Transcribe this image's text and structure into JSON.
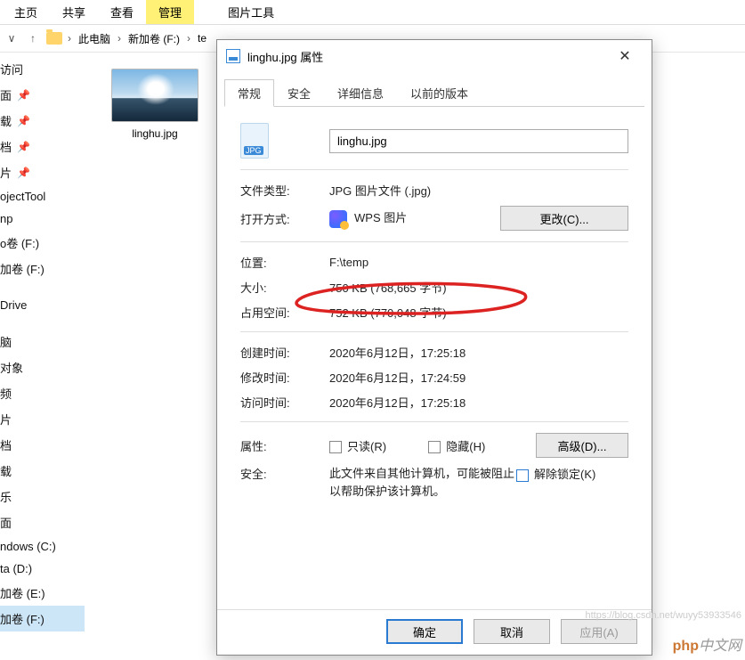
{
  "ribbon": {
    "tabs": [
      "主页",
      "共享",
      "查看"
    ],
    "context_group": "管理",
    "context_tab": "图片工具"
  },
  "breadcrumbs": {
    "items": [
      "此电脑",
      "新加卷 (F:)",
      "te"
    ],
    "address_extra": "temp"
  },
  "sidebar": {
    "items": [
      "访问",
      "面",
      "载",
      "档",
      "片",
      "ojectTool",
      "np",
      "o卷 (F:)",
      "加卷 (F:)",
      "Drive",
      "脑",
      "对象",
      "频",
      "片",
      "档",
      "载",
      "乐",
      "面",
      "ndows (C:)",
      "ta (D:)",
      "加卷 (E:)",
      "加卷 (F:)"
    ]
  },
  "file": {
    "thumb_label": "linghu.jpg"
  },
  "dialog": {
    "title": "linghu.jpg 属性",
    "tabs": {
      "general": "常规",
      "security": "安全",
      "details": "详细信息",
      "previous": "以前的版本"
    },
    "filename": "linghu.jpg",
    "labels": {
      "filetype": "文件类型:",
      "openwith": "打开方式:",
      "location": "位置:",
      "size": "大小:",
      "sizeondisk": "占用空间:",
      "created": "创建时间:",
      "modified": "修改时间:",
      "accessed": "访问时间:",
      "attributes": "属性:",
      "security": "安全:"
    },
    "values": {
      "filetype": "JPG 图片文件 (.jpg)",
      "openwith": "WPS 图片",
      "location": "F:\\temp",
      "size": "750 KB (768,665 字节)",
      "sizeondisk": "752 KB (770,048 字节)",
      "created": "2020年6月12日，17:25:18",
      "modified": "2020年6月12日，17:24:59",
      "accessed": "2020年6月12日，17:25:18",
      "security_msg": "此文件来自其他计算机，可能被阻止以帮助保护该计算机。"
    },
    "buttons": {
      "change": "更改(C)...",
      "advanced": "高级(D)...",
      "readonly": "只读(R)",
      "hidden": "隐藏(H)",
      "unblock": "解除锁定(K)",
      "ok": "确定",
      "cancel": "取消",
      "apply": "应用(A)"
    }
  },
  "watermark": {
    "brand": "php中文网",
    "url": "https://blog.csdn.net/wuyy53933546"
  }
}
